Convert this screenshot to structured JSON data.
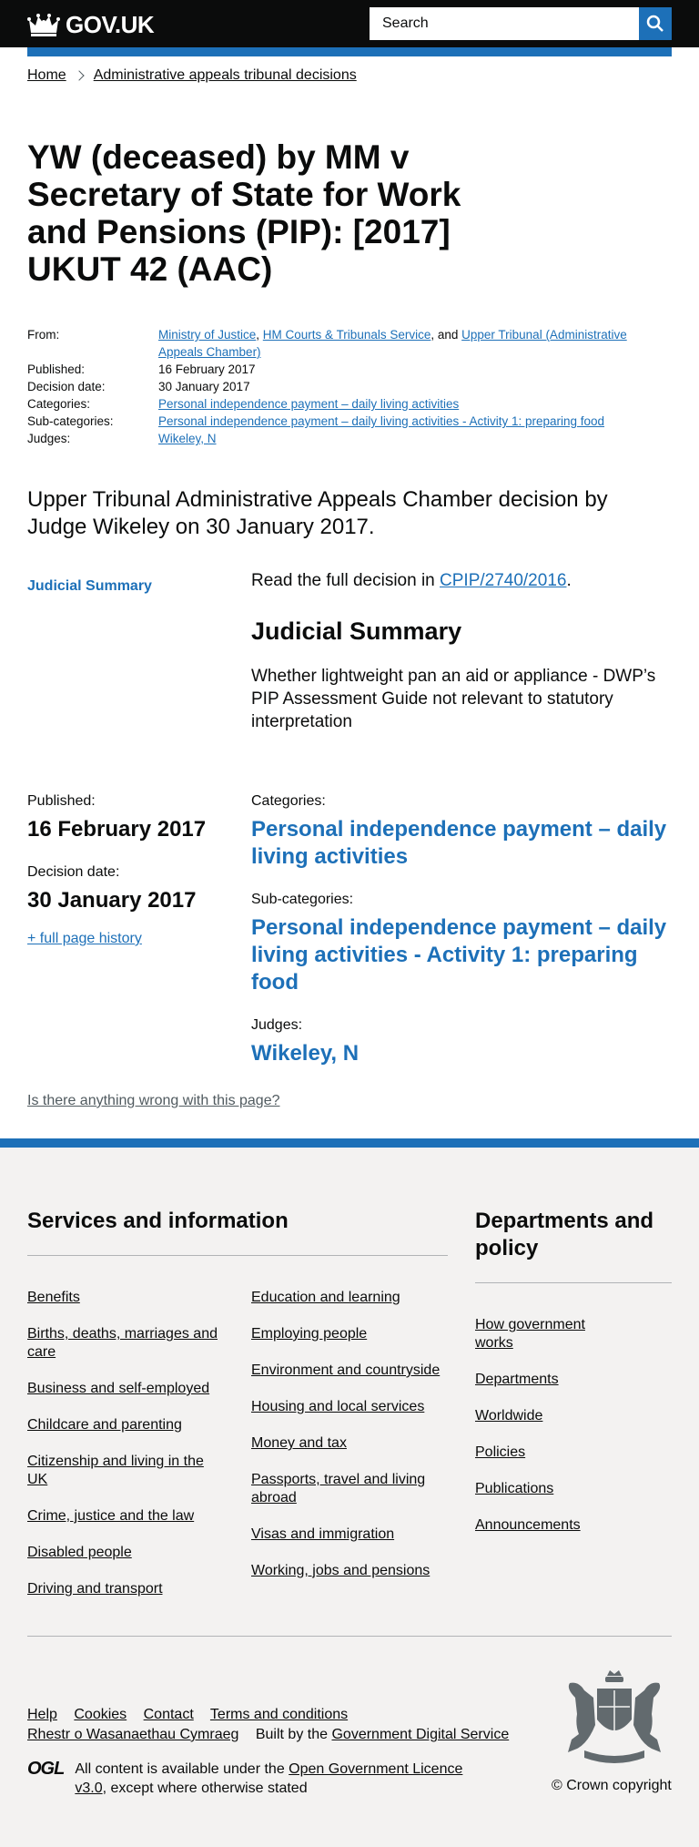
{
  "header": {
    "logo_text": "GOV.UK",
    "search_placeholder": "Search"
  },
  "breadcrumb": {
    "home": "Home",
    "section": "Administrative appeals tribunal decisions"
  },
  "title": "YW (deceased) by MM v Secretary of State for Work and Pensions (PIP): [2017] UKUT 42 (AAC)",
  "metadata": {
    "from_label": "From:",
    "org1": "Ministry of Justice",
    "org2": "HM Courts & Tribunals Service",
    "org3": "Upper Tribunal (Administrative Appeals Chamber)",
    "sep_comma": ", ",
    "sep_and": ", and ",
    "published_label": "Published:",
    "published": "16 February 2017",
    "decision_label": "Decision date:",
    "decision": "30 January 2017",
    "categories_label": "Categories:",
    "category": "Personal independence payment – daily living activities",
    "subcategories_label": "Sub-categories:",
    "subcategory": "Personal independence payment – daily living activities - Activity 1: preparing food",
    "judges_label": "Judges:",
    "judge": "Wikeley, N"
  },
  "lead": "Upper Tribunal Administrative Appeals Chamber decision by Judge Wikeley on 30 January 2017.",
  "side_nav": "Judicial Summary",
  "body": {
    "read_prefix": "Read the full decision in ",
    "decision_link": "CPIP/2740/2016",
    "read_suffix": ".",
    "heading": "Judicial Summary",
    "summary": "Whether lightweight pan an aid or appliance - DWP’s PIP Assessment Guide not relevant to statutory interpretation"
  },
  "bottom_meta": {
    "published_label": "Published:",
    "published": "16 February 2017",
    "decision_label": "Decision date:",
    "decision": "30 January 2017",
    "history": "+ full page history",
    "categories_label": "Categories:",
    "category": "Personal independence payment – daily living activities",
    "subcategories_label": "Sub-categories:",
    "subcategory": "Personal independence payment – daily living activities - Activity 1: preparing food",
    "judges_label": "Judges:",
    "judge": "Wikeley, N"
  },
  "report_link": "Is there anything wrong with this page?",
  "footer": {
    "services_heading": "Services and information",
    "services_col1": [
      "Benefits",
      "Births, deaths, marriages and care",
      "Business and self-employed",
      "Childcare and parenting",
      "Citizenship and living in the UK",
      "Crime, justice and the law",
      "Disabled people",
      "Driving and transport"
    ],
    "services_col2": [
      "Education and learning",
      "Employing people",
      "Environment and countryside",
      "Housing and local services",
      "Money and tax",
      "Passports, travel and living abroad",
      "Visas and immigration",
      "Working, jobs and pensions"
    ],
    "departments_heading": "Departments and policy",
    "departments": [
      "How government works",
      "Departments",
      "Worldwide",
      "Policies",
      "Publications",
      "Announcements"
    ],
    "meta_links": [
      "Help",
      "Cookies",
      "Contact",
      "Terms and conditions"
    ],
    "welsh": "Rhestr o Wasanaethau Cymraeg",
    "built_by_prefix": "Built by the ",
    "built_by_link": "Government Digital Service",
    "ogl_logo": "OGL",
    "licence_prefix": "All content is available under the ",
    "licence_link": "Open Government Licence v3.0",
    "licence_suffix": ", except where otherwise stated",
    "copyright": "© Crown copyright"
  }
}
